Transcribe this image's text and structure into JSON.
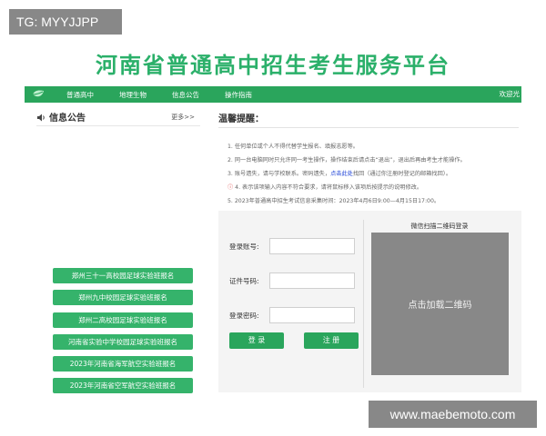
{
  "tg_badge": "TG: MYYJJPP",
  "site_title": "河南省普通高中招生考生服务平台",
  "nav": {
    "items": [
      "普通高中",
      "地理生物",
      "信息公告",
      "操作指南"
    ],
    "right": "欢迎光"
  },
  "notice": {
    "title": "信息公告",
    "more": "更多>>"
  },
  "links": [
    "郑州三十一高校园足球实验班报名",
    "郑州九中校园足球实验班报名",
    "郑州二高校园足球实验班报名",
    "河南省实验中学校园足球实验班报名",
    "2023年河南省海军航空实验班报名",
    "2023年河南省空军航空实验班报名"
  ],
  "tips": {
    "title": "温馨提醒：",
    "items": [
      {
        "pre": "1. 任何单位或个人不得代替学生报名、填报志愿等。",
        "hl": "",
        "post": ""
      },
      {
        "pre": "2. 同一台电脑同时只允许同一考生操作，操作结束后请点击“退出”，退出后再由考生才能操作。",
        "hl": "",
        "post": ""
      },
      {
        "pre": "3. 账号遗失，请与学校联系。密码遗失，",
        "hl": "点击此处",
        "post": "找回（通过你注册时登记的邮箱找回）。"
      },
      {
        "pre": "4. 表示该项输入内容不符合要求，请将鼠标移入该项后按提示的说明修改。",
        "hl": "",
        "post": ""
      },
      {
        "pre": "5. 2023年普通高中招生考试信息采集时间：2023年4月6日9:00—4月15日17:00。",
        "hl": "",
        "post": ""
      }
    ]
  },
  "login": {
    "account_label": "登录账号:",
    "id_label": "证件号码:",
    "password_label": "登录密码:",
    "login_button": "登 录",
    "register_button": "注 册"
  },
  "qr": {
    "title": "微信扫描二维码登录",
    "placeholder": "点击加载二维码"
  },
  "watermark": "www.maebemoto.com"
}
